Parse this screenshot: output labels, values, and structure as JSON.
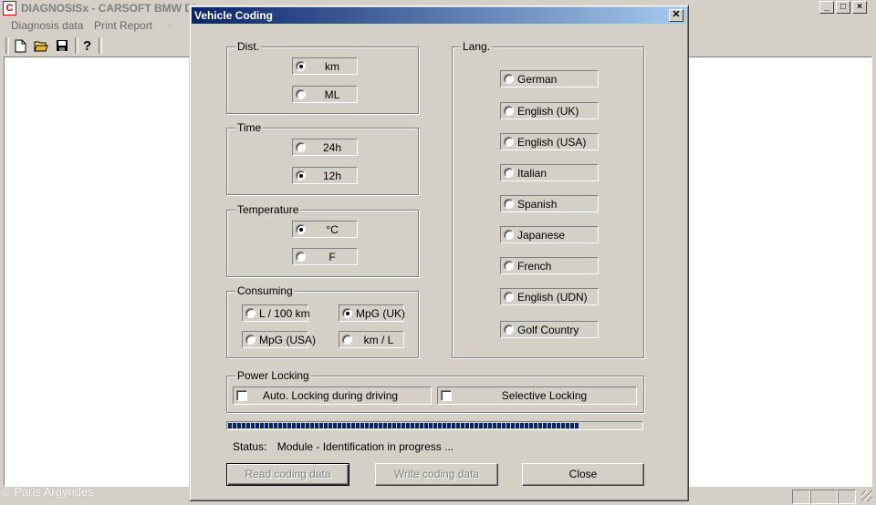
{
  "app": {
    "title": "DIAGNOSISx - CARSOFT BMW Dia",
    "logo_letter": "C",
    "menu": [
      "Diagnosis data",
      "Print Report"
    ],
    "watermark": "© Paris Argyrides"
  },
  "dialog": {
    "title": "Vehicle Coding",
    "close_glyph": "✕",
    "dist": {
      "legend": "Dist.",
      "options": [
        {
          "label": "km",
          "selected": true
        },
        {
          "label": "ML",
          "selected": false
        }
      ]
    },
    "time": {
      "legend": "Time",
      "options": [
        {
          "label": "24h",
          "selected": false
        },
        {
          "label": "12h",
          "selected": true
        }
      ]
    },
    "temperature": {
      "legend": "Temperature",
      "options": [
        {
          "label": "°C",
          "selected": true
        },
        {
          "label": "F",
          "selected": false
        }
      ]
    },
    "consuming": {
      "legend": "Consuming",
      "options": [
        {
          "label": "L / 100 km",
          "selected": false
        },
        {
          "label": "MpG (UK)",
          "selected": true
        },
        {
          "label": "MpG (USA)",
          "selected": false
        },
        {
          "label": "km / L",
          "selected": false
        }
      ]
    },
    "lang": {
      "legend": "Lang.",
      "options": [
        {
          "label": "German",
          "selected": false
        },
        {
          "label": "English (UK)",
          "selected": false
        },
        {
          "label": "English (USA)",
          "selected": false
        },
        {
          "label": "Italian",
          "selected": false
        },
        {
          "label": "Spanish",
          "selected": false
        },
        {
          "label": "Japanese",
          "selected": false
        },
        {
          "label": "French",
          "selected": false
        },
        {
          "label": "English (UDN)",
          "selected": false
        },
        {
          "label": "Golf Country",
          "selected": false
        }
      ]
    },
    "power_locking": {
      "legend": "Power Locking",
      "auto": {
        "label": "Auto. Locking during driving",
        "checked": false
      },
      "selective": {
        "label": "Selective Locking",
        "checked": false
      }
    },
    "progress_fraction": 0.85,
    "status": {
      "label": "Status:",
      "text": "Module - Identification in progress ..."
    },
    "buttons": {
      "read": {
        "label": "Read coding data",
        "enabled": false
      },
      "write": {
        "label": "Write coding data",
        "enabled": false
      },
      "close": {
        "label": "Close",
        "enabled": true
      }
    }
  }
}
